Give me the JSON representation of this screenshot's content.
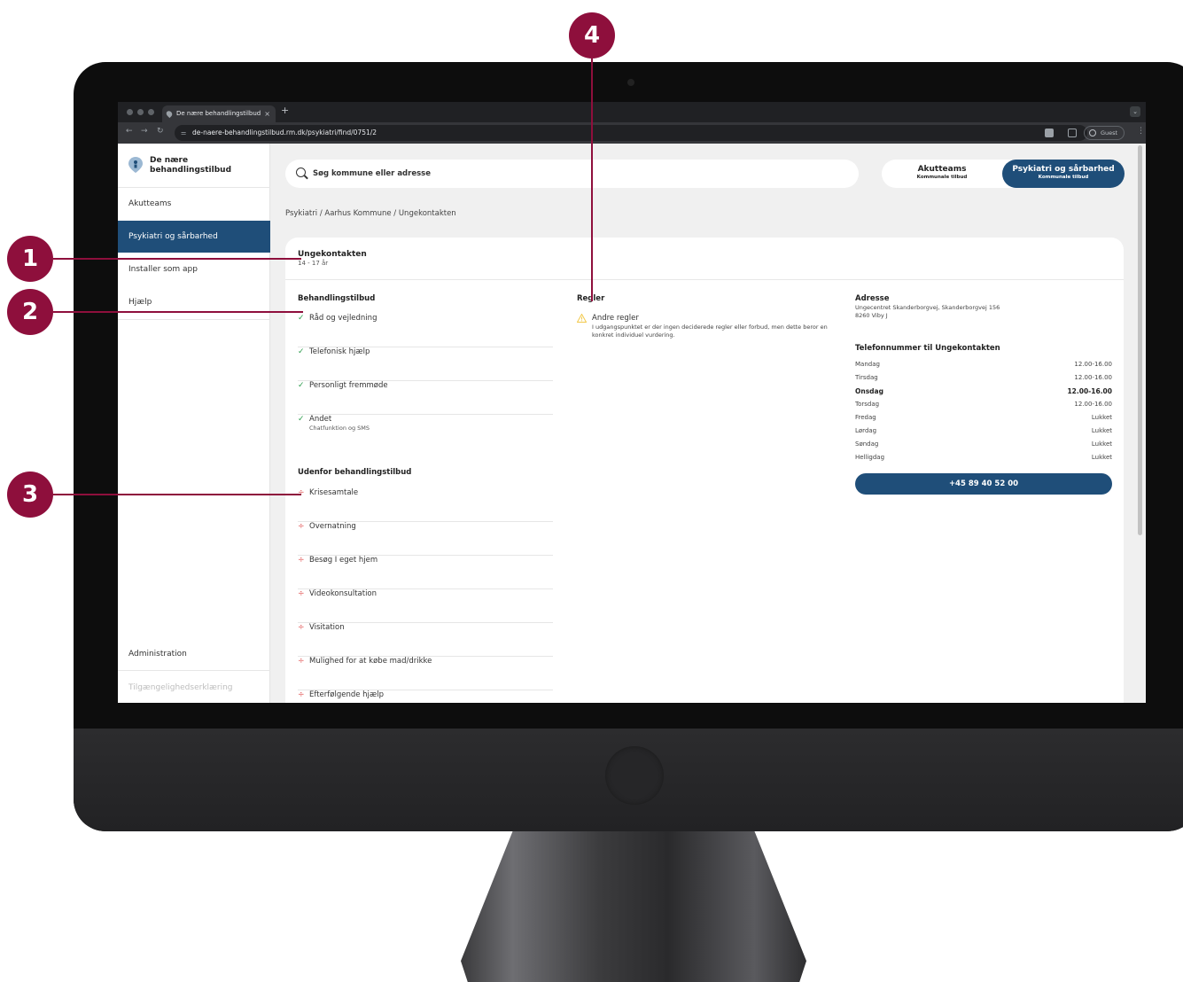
{
  "browser": {
    "tab_title": "De nære behandlingstilbud",
    "tab_close": "×",
    "new_tab": "+",
    "url": "de-naere-behandlingstilbud.rm.dk/psykiatri/find/0751/2",
    "guest_label": "Guest"
  },
  "sidebar": {
    "logo_text": "De nære behandlingstilbud",
    "items": [
      {
        "label": "Akutteams",
        "active": false
      },
      {
        "label": "Psykiatri og sårbarhed",
        "active": true
      },
      {
        "label": "Installer som app",
        "active": false
      },
      {
        "label": "Hjælp",
        "active": false
      }
    ],
    "admin_label": "Administration",
    "accessibility_label": "Tilgængelighedserklæring"
  },
  "search": {
    "placeholder": "Søg kommune eller adresse"
  },
  "toggle": {
    "option1_title": "Akutteams",
    "option1_sub": "Kommunale tilbud",
    "option2_title": "Psykiatri og sårbarhed",
    "option2_sub": "Kommunale tilbud"
  },
  "breadcrumb": "Psykiatri / Aarhus Kommune / Ungekontakten",
  "place": {
    "name": "Ungekontakten",
    "age": "14 - 17 år"
  },
  "offers": {
    "heading": "Behandlingstilbud",
    "items": [
      {
        "label": "Råd og vejledning",
        "sub": ""
      },
      {
        "label": "Telefonisk hjælp",
        "sub": ""
      },
      {
        "label": "Personligt fremmøde",
        "sub": ""
      },
      {
        "label": "Andet",
        "sub": "Chatfunktion og SMS"
      }
    ],
    "check_icon": "✓"
  },
  "outside": {
    "heading": "Udenfor behandlingstilbud",
    "items": [
      "Krisesamtale",
      "Overnatning",
      "Besøg I eget hjem",
      "Videokonsultation",
      "Visitation",
      "Mulighed for at købe mad/drikke",
      "Efterfølgende hjælp"
    ],
    "cross_icon": "÷"
  },
  "rules": {
    "heading": "Regler",
    "title": "Andre regler",
    "text": "I udgangspunktet er der ingen deciderede regler eller forbud, men dette beror en konkret individuel vurdering."
  },
  "address": {
    "heading": "Adresse",
    "line1": "Ungecentret Skanderborgvej, Skanderborgvej 156",
    "line2": "8260 Viby J"
  },
  "hours": {
    "heading": "Telefonnummer til Ungekontakten",
    "rows": [
      {
        "day": "Mandag",
        "time": "12.00-16.00"
      },
      {
        "day": "Tirsdag",
        "time": "12.00-16.00"
      },
      {
        "day": "Onsdag",
        "time": "12.00-16.00"
      },
      {
        "day": "Torsdag",
        "time": "12.00-16.00"
      },
      {
        "day": "Fredag",
        "time": "Lukket"
      },
      {
        "day": "Lørdag",
        "time": "Lukket"
      },
      {
        "day": "Søndag",
        "time": "Lukket"
      },
      {
        "day": "Helligdag",
        "time": "Lukket"
      }
    ],
    "phone": "+45 89 40 52 00"
  },
  "callouts": [
    "1",
    "2",
    "3",
    "4"
  ],
  "colors": {
    "brand": "#1f4e79",
    "callout": "#8e0f3c",
    "ok": "#2e9d4f",
    "no": "#e05252",
    "warning": "#f2c94c"
  }
}
